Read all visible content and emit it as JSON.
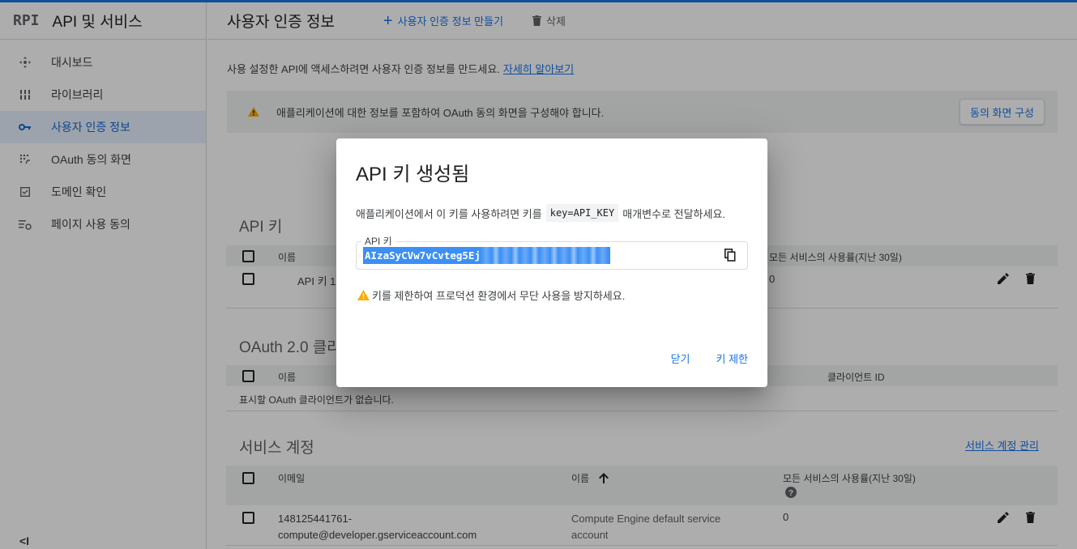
{
  "brand": {
    "logo": "RPI",
    "title": "API 및 서비스"
  },
  "sidebar": {
    "items": [
      {
        "label": "대시보드",
        "icon": "dashboard-icon"
      },
      {
        "label": "라이브러리",
        "icon": "library-icon"
      },
      {
        "label": "사용자 인증 정보",
        "icon": "key-icon",
        "active": true
      },
      {
        "label": "OAuth 동의 화면",
        "icon": "oauth-consent-icon"
      },
      {
        "label": "도메인 확인",
        "icon": "domain-check-icon"
      },
      {
        "label": "페이지 사용 동의",
        "icon": "page-consent-icon"
      }
    ],
    "collapse_label": "<I"
  },
  "header": {
    "title": "사용자 인증 정보",
    "create_label": "사용자 인증 정보 만들기",
    "delete_label": "삭제"
  },
  "main": {
    "intro_text": "사용 설정한 API에 액세스하려면 사용자 인증 정보를 만드세요.",
    "learn_more": "자세히 알아보기",
    "notice_text": "애플리케이션에 대한 정보를 포함하여 OAuth 동의 화면을 구성해야 합니다.",
    "notice_button": "동의 화면 구성",
    "api_keys": {
      "title": "API 키",
      "col_name": "이름",
      "col_usage": "모든 서비스의 사용률(지난 30일)",
      "row_name": "API 키 1",
      "row_usage": "0"
    },
    "oauth": {
      "title": "OAuth 2.0 클라이언트 ID",
      "col_name": "이름",
      "col_client": "클라이언트 ID",
      "empty_text": "표시할 OAuth 클라이언트가 없습니다."
    },
    "service_accounts": {
      "title": "서비스 계정",
      "manage_link": "서비스 계정 관리",
      "col_email": "이메일",
      "col_name": "이름",
      "col_usage": "모든 서비스의 사용률(지난 30일)",
      "row_email_1": "148125441761-",
      "row_email_2": "compute@developer.gserviceaccount.com",
      "row_name_1": "Compute Engine default service",
      "row_name_2": "account",
      "row_usage": "0"
    }
  },
  "dialog": {
    "title": "API 키 생성됨",
    "desc_before": "애플리케이션에서 이 키를 사용하려면 키를",
    "desc_code": "key=API_KEY",
    "desc_after": "매개변수로 전달하세요.",
    "key_label": "API 키",
    "key_value_visible": "AIzaSyCVw7vCvteg5Ej",
    "warning": "키를 제한하여 프로덕션 환경에서 무단 사용을 방지하세요.",
    "close_label": "닫기",
    "restrict_label": "키 제한"
  },
  "colors": {
    "accent": "#1a73e8",
    "warning": "#f9ab00",
    "active_bg": "#e8f0fe"
  }
}
